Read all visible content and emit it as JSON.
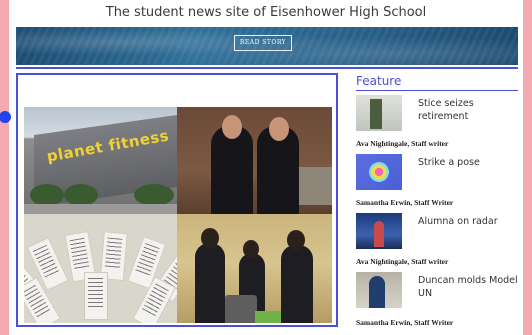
{
  "header": {
    "tagline": "The student news site of Eisenhower High School",
    "banner_button": "READ STORY"
  },
  "main_story": {
    "photo_sign": "planet fitness"
  },
  "feature": {
    "heading": "Feature",
    "items": [
      {
        "title": "Stice seizes retirement",
        "byline": "Ava Nightingale, Staff writer"
      },
      {
        "title": "Strike a pose",
        "byline": "Samantha Erwin, Staff Writer"
      },
      {
        "title": "Alumna on radar",
        "byline": "Ava Nightingale, Staff writer"
      },
      {
        "title": "Duncan molds Model UN",
        "byline": "Samantha Erwin, Staff Writer"
      }
    ]
  },
  "colors": {
    "accent": "#4b50d8",
    "background": "#f4aab0"
  }
}
